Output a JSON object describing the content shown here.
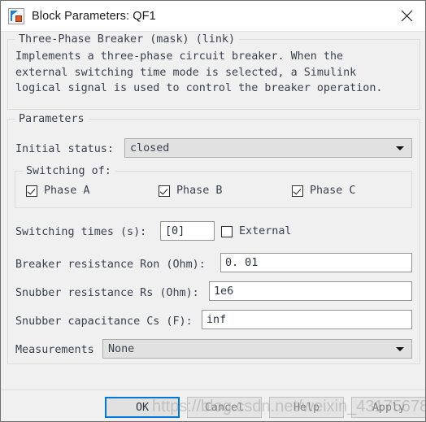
{
  "window": {
    "title": "Block Parameters: QF1",
    "icon": "simulink-block-icon",
    "close_label": "close-icon"
  },
  "description": {
    "legend": "Three-Phase Breaker (mask) (link)",
    "text": "Implements a three-phase circuit breaker. When the\nexternal switching time mode is selected, a Simulink\nlogical signal is used to control the breaker operation."
  },
  "parameters": {
    "legend": "Parameters",
    "initial_status": {
      "label": "Initial status:",
      "value": "closed"
    },
    "switching_of": {
      "legend": "Switching of:",
      "phases": [
        {
          "label": "Phase A",
          "checked": true
        },
        {
          "label": "Phase B",
          "checked": true
        },
        {
          "label": "Phase C",
          "checked": true
        }
      ]
    },
    "switching_times": {
      "label": "Switching times (s):",
      "value": "[0]",
      "external": {
        "label": "External",
        "checked": false
      }
    },
    "breaker_resistance": {
      "label": "Breaker resistance Ron (Ohm):",
      "value": "0. 01"
    },
    "snubber_resistance": {
      "label": "Snubber resistance Rs (Ohm):",
      "value": "1e6"
    },
    "snubber_capacitance": {
      "label": "Snubber capacitance Cs (F):",
      "value": "inf"
    },
    "measurements": {
      "label": "Measurements",
      "value": "None"
    }
  },
  "footer": {
    "ok": "OK",
    "cancel": "Cancel",
    "help": "Help",
    "apply": "Apply"
  },
  "watermark": {
    "text": "https://blog.csdn.net/weixin_43175678"
  },
  "colors": {
    "dialog_background": "#f0f0f0",
    "titlebar_background": "#ffffff",
    "accent_focus": "#0078d7",
    "text": "#3a3f4a",
    "field_background": "#ffffff",
    "combo_background": "#e1e1e1"
  }
}
